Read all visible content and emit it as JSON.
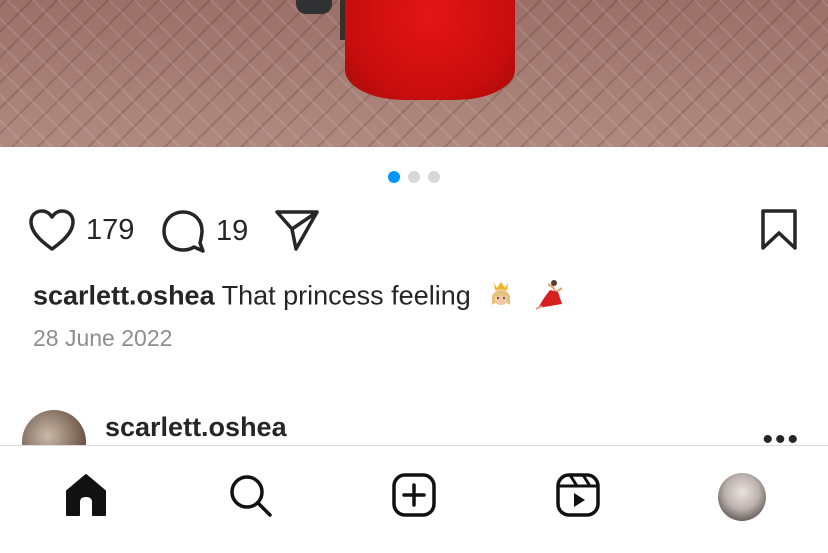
{
  "post": {
    "carousel": {
      "total": 3,
      "active": 1
    },
    "likes": "179",
    "comments": "19",
    "caption_user": "scarlett.oshea",
    "caption_text": "That princess feeling",
    "caption_emojis": [
      "princess-emoji",
      "dancer-emoji"
    ],
    "date": "28 June 2022"
  },
  "next_post": {
    "username": "scarlett.oshea",
    "more_label": "•••"
  },
  "tabbar": {
    "tabs": [
      "home-icon",
      "search-icon",
      "create-icon",
      "reels-icon",
      "profile-avatar"
    ]
  },
  "colors": {
    "accent": "#0095f6",
    "text": "#262626",
    "muted": "#8e8e8e"
  }
}
